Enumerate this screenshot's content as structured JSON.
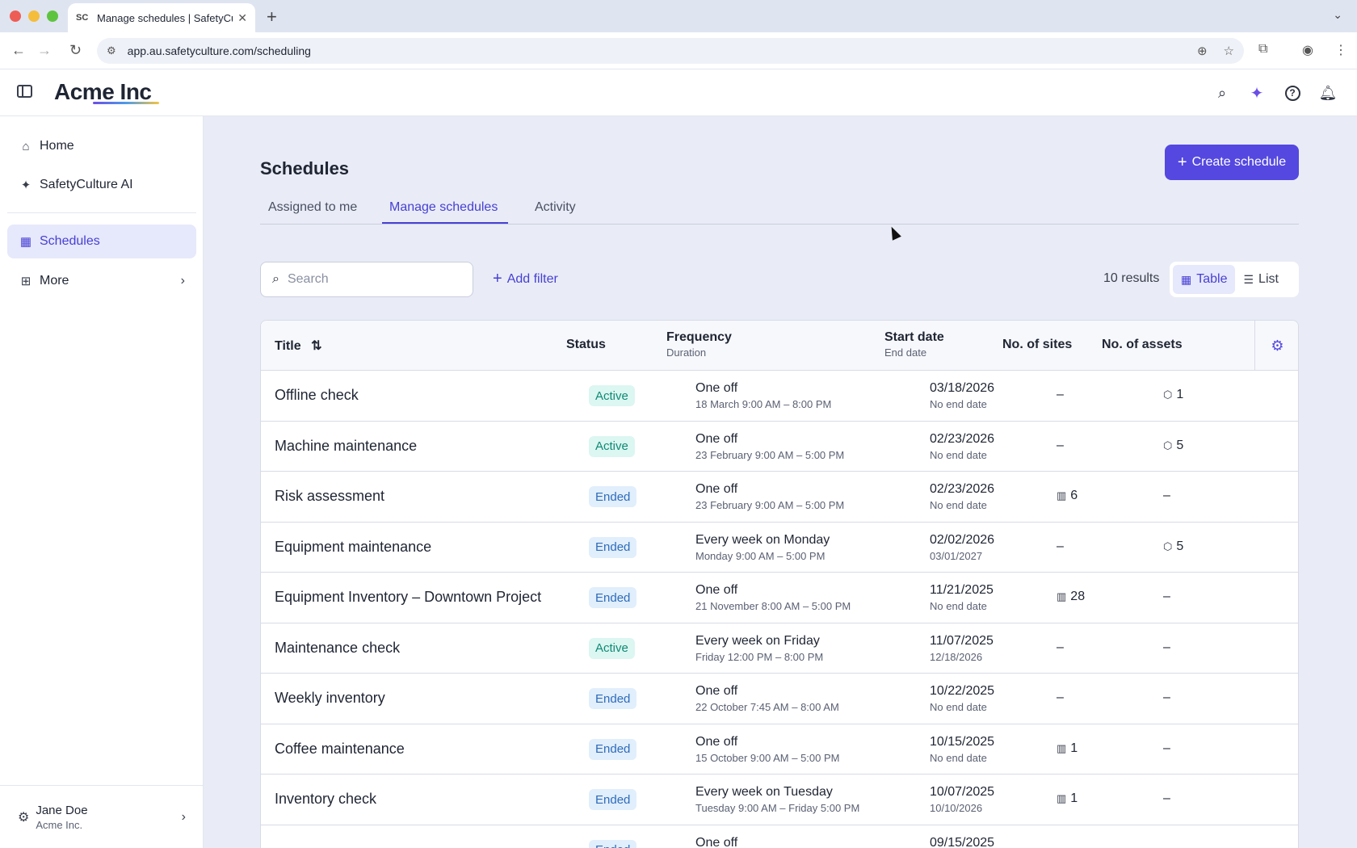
{
  "browser": {
    "tab_title": "Manage schedules | SafetyCulture",
    "favicon": "SC",
    "url": "app.au.safetyculture.com/scheduling"
  },
  "app": {
    "logo": "Acme Inc"
  },
  "sidebar": {
    "items": [
      {
        "label": "Home",
        "icon": "home-icon"
      },
      {
        "label": "SafetyCulture AI",
        "icon": "sparkle-icon"
      },
      {
        "label": "Schedules",
        "icon": "calendar-icon",
        "active": true
      },
      {
        "label": "More",
        "icon": "grid-icon"
      }
    ],
    "user": {
      "name": "Jane Doe",
      "org": "Acme Inc."
    }
  },
  "main": {
    "title": "Schedules",
    "create_label": "Create schedule",
    "tabs": [
      {
        "label": "Assigned to me"
      },
      {
        "label": "Manage schedules",
        "active": true
      },
      {
        "label": "Activity"
      }
    ],
    "search_placeholder": "Search",
    "add_filter_label": "Add filter",
    "results": "10 results",
    "view_table_label": "Table",
    "view_list_label": "List"
  },
  "table": {
    "headers": {
      "title": "Title",
      "status": "Status",
      "frequency": "Frequency",
      "duration": "Duration",
      "start": "Start date",
      "end": "End date",
      "sites": "No. of sites",
      "assets": "No. of assets"
    },
    "rows": [
      {
        "title": "Offline check",
        "status": "Active",
        "freq": "One off",
        "duration": "18 March 9:00 AM – 8:00 PM",
        "start": "03/18/2026",
        "end": "No end date",
        "sites": "–",
        "assets": "1"
      },
      {
        "title": "Machine maintenance",
        "status": "Active",
        "freq": "One off",
        "duration": "23 February 9:00 AM – 5:00 PM",
        "start": "02/23/2026",
        "end": "No end date",
        "sites": "–",
        "assets": "5"
      },
      {
        "title": "Risk assessment",
        "status": "Ended",
        "freq": "One off",
        "duration": "23 February 9:00 AM – 5:00 PM",
        "start": "02/23/2026",
        "end": "No end date",
        "sites": "6",
        "assets": "–"
      },
      {
        "title": "Equipment maintenance",
        "status": "Ended",
        "freq": "Every week on Monday",
        "duration": "Monday 9:00 AM – 5:00 PM",
        "start": "02/02/2026",
        "end": "03/01/2027",
        "sites": "–",
        "assets": "5"
      },
      {
        "title": "Equipment Inventory – Downtown Project",
        "status": "Ended",
        "freq": "One off",
        "duration": "21 November 8:00 AM – 5:00 PM",
        "start": "11/21/2025",
        "end": "No end date",
        "sites": "28",
        "assets": "–"
      },
      {
        "title": "Maintenance check",
        "status": "Active",
        "freq": "Every week on Friday",
        "duration": "Friday 12:00 PM – 8:00 PM",
        "start": "11/07/2025",
        "end": "12/18/2026",
        "sites": "–",
        "assets": "–"
      },
      {
        "title": "Weekly inventory",
        "status": "Ended",
        "freq": "One off",
        "duration": "22 October 7:45 AM – 8:00 AM",
        "start": "10/22/2025",
        "end": "No end date",
        "sites": "–",
        "assets": "–"
      },
      {
        "title": "Coffee maintenance",
        "status": "Ended",
        "freq": "One off",
        "duration": "15 October 9:00 AM – 5:00 PM",
        "start": "10/15/2025",
        "end": "No end date",
        "sites": "1",
        "assets": "–"
      },
      {
        "title": "Inventory check",
        "status": "Ended",
        "freq": "Every week on Tuesday",
        "duration": "Tuesday 9:00 AM – Friday 5:00 PM",
        "start": "10/07/2025",
        "end": "10/10/2026",
        "sites": "1",
        "assets": "–"
      },
      {
        "title": "",
        "status": "Ended",
        "freq": "One off",
        "duration": "",
        "start": "09/15/2025",
        "end": "",
        "sites": "",
        "assets": ""
      }
    ]
  }
}
